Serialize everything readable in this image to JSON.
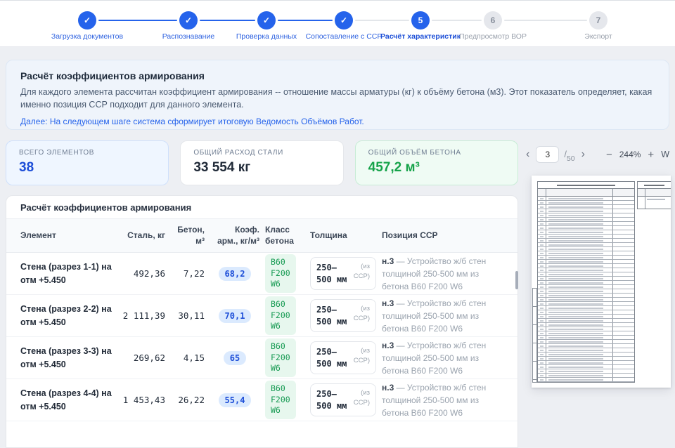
{
  "stepper": {
    "steps": [
      {
        "label": "Загрузка документов",
        "status": "completed",
        "icon": "✓"
      },
      {
        "label": "Распознавание",
        "status": "completed",
        "icon": "✓"
      },
      {
        "label": "Проверка данных",
        "status": "completed",
        "icon": "✓"
      },
      {
        "label": "Сопоставление с ССР",
        "status": "completed",
        "icon": "✓"
      },
      {
        "label": "Расчёт характеристик",
        "status": "active",
        "icon": "5"
      },
      {
        "label": "Предпросмотр ВОР",
        "status": "upcoming",
        "icon": "6"
      },
      {
        "label": "Экспорт",
        "status": "upcoming",
        "icon": "7"
      }
    ]
  },
  "info_panel": {
    "title": "Расчёт коэффициентов армирования",
    "body": "Для каждого элемента рассчитан коэффициент армирования -- отношение массы арматуры (кг) к объёму бетона (м3). Этот показатель определяет, какая именно позиция ССР подходит для данного элемента.",
    "next_note": "Далее: На следующем шаге система сформирует итоговую Ведомость Объёмов Работ."
  },
  "summary_cards": [
    {
      "label": "ВСЕГО ЭЛЕМЕНТОВ",
      "value": "38",
      "accent": "#1d4ed8"
    },
    {
      "label": "ОБЩИЙ РАСХОД СТАЛИ",
      "value": "33 554 кг",
      "accent": "#1f2937"
    },
    {
      "label": "ОБЩИЙ ОБЪЁМ БЕТОНА",
      "value": "457,2 м³",
      "accent": "#16a34a"
    }
  ],
  "table": {
    "title": "Расчёт коэффициентов армирования",
    "columns": [
      "Элемент",
      "Сталь, кг",
      "Бетон,\nм³",
      "Коэф.\nарм., кг/м³",
      "Класс\nбетона",
      "Толщина",
      "Позиция ССР"
    ],
    "rows": [
      {
        "element": "Стена (разрез 1-1) на отм +5.450",
        "steel": "492,36",
        "concrete": "7,22",
        "coef": "68,2",
        "concrete_class": "B60\nF200\nW6",
        "thickness": "250–500 мм",
        "thickness_source": "(из ССР)",
        "position_code": "н.3",
        "position_text": " — Устройство ж/б стен толщиной 250-500 мм из бетона B60 F200 W6"
      },
      {
        "element": "Стена (разрез 2-2) на отм +5.450",
        "steel": "2 111,39",
        "concrete": "30,11",
        "coef": "70,1",
        "concrete_class": "B60\nF200\nW6",
        "thickness": "250–500 мм",
        "thickness_source": "(из ССР)",
        "position_code": "н.3",
        "position_text": " — Устройство ж/б стен толщиной 250-500 мм из бетона B60 F200 W6"
      },
      {
        "element": "Стена (разрез 3-3) на отм +5.450",
        "steel": "269,62",
        "concrete": "4,15",
        "coef": "65",
        "concrete_class": "B60\nF200\nW6",
        "thickness": "250–500 мм",
        "thickness_source": "(из ССР)",
        "position_code": "н.3",
        "position_text": " — Устройство ж/б стен толщиной 250-500 мм из бетона B60 F200 W6"
      },
      {
        "element": "Стена (разрез 4-4) на отм +5.450",
        "steel": "1 453,43",
        "concrete": "26,22",
        "coef": "55,4",
        "concrete_class": "B60\nF200\nW6",
        "thickness": "250–500 мм",
        "thickness_source": "(из ССР)",
        "position_code": "н.3",
        "position_text": " — Устройство ж/б стен толщиной 250-500 мм из бетона B60 F200 W6"
      }
    ]
  },
  "preview": {
    "toolbar": {
      "prev_icon": "‹",
      "page": "3",
      "divider": "/",
      "total": "50",
      "next_icon": "›",
      "zoom_out_icon": "−",
      "zoom_level": "244%",
      "zoom_in_icon": "+",
      "fit_width_label": "W"
    }
  },
  "colors": {
    "accent_blue": "#2563eb",
    "success_green": "#16a34a"
  }
}
